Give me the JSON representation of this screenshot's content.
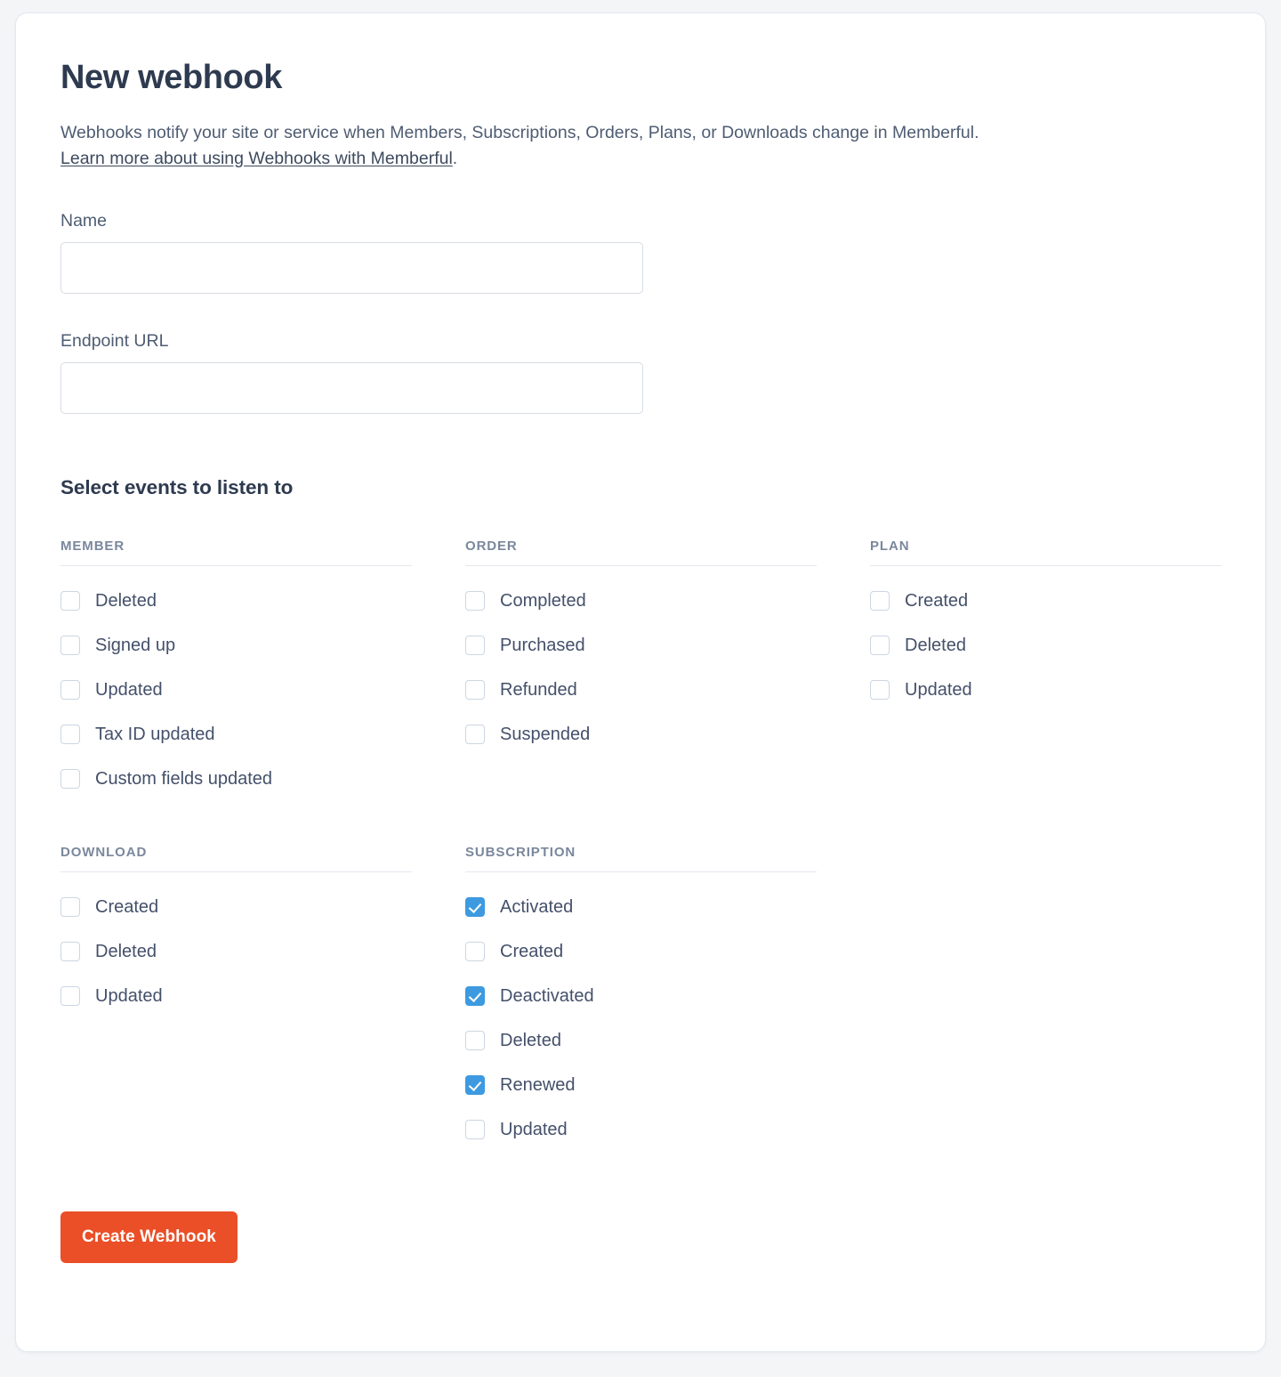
{
  "form": {
    "title": "New webhook",
    "intro_text": "Webhooks notify your site or service when Members, Subscriptions, Orders, Plans, or Downloads change in Memberful.",
    "intro_link": "Learn more about using Webhooks with Memberful",
    "intro_link_suffix": ".",
    "name_label": "Name",
    "name_value": "",
    "name_placeholder": "",
    "endpoint_label": "Endpoint URL",
    "endpoint_value": "",
    "endpoint_placeholder": "",
    "events_heading": "Select events to listen to",
    "submit_label": "Create Webhook"
  },
  "colors": {
    "accent_button": "#ea4f27",
    "checkbox_checked": "#3d9ae0",
    "heading_text": "#2e3a4f",
    "body_text": "#4e5c72",
    "section_header_text": "#7a879c",
    "page_background": "#f4f5f7",
    "card_background": "#ffffff",
    "border": "#e3e8ef"
  },
  "event_groups": [
    {
      "key": "member",
      "title": "MEMBER",
      "events": [
        {
          "label": "Deleted",
          "checked": false
        },
        {
          "label": "Signed up",
          "checked": false
        },
        {
          "label": "Updated",
          "checked": false
        },
        {
          "label": "Tax ID updated",
          "checked": false
        },
        {
          "label": "Custom fields updated",
          "checked": false
        }
      ]
    },
    {
      "key": "order",
      "title": "ORDER",
      "events": [
        {
          "label": "Completed",
          "checked": false
        },
        {
          "label": "Purchased",
          "checked": false
        },
        {
          "label": "Refunded",
          "checked": false
        },
        {
          "label": "Suspended",
          "checked": false
        }
      ]
    },
    {
      "key": "plan",
      "title": "PLAN",
      "events": [
        {
          "label": "Created",
          "checked": false
        },
        {
          "label": "Deleted",
          "checked": false
        },
        {
          "label": "Updated",
          "checked": false
        }
      ]
    },
    {
      "key": "download",
      "title": "DOWNLOAD",
      "events": [
        {
          "label": "Created",
          "checked": false
        },
        {
          "label": "Deleted",
          "checked": false
        },
        {
          "label": "Updated",
          "checked": false
        }
      ]
    },
    {
      "key": "subscription",
      "title": "SUBSCRIPTION",
      "events": [
        {
          "label": "Activated",
          "checked": true
        },
        {
          "label": "Created",
          "checked": false
        },
        {
          "label": "Deactivated",
          "checked": true
        },
        {
          "label": "Deleted",
          "checked": false
        },
        {
          "label": "Renewed",
          "checked": true
        },
        {
          "label": "Updated",
          "checked": false
        }
      ]
    }
  ]
}
